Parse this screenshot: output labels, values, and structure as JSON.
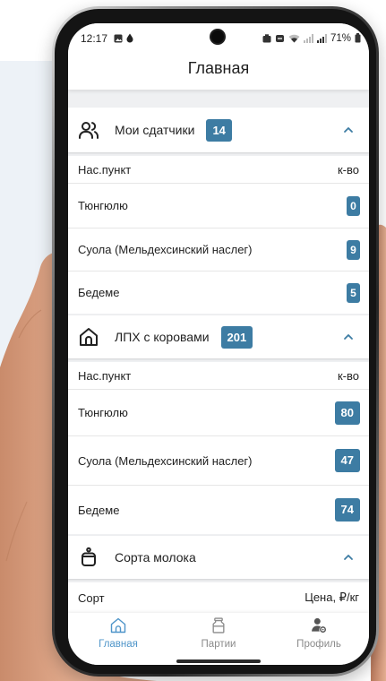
{
  "status_bar": {
    "time": "12:17",
    "battery": "71%",
    "left_icons": [
      "gallery-icon",
      "drop-icon"
    ],
    "right_icons": [
      "battery-saver-icon",
      "alarm-icon",
      "wifi-icon",
      "signal-icon",
      "signal-icon-secondary",
      "battery-icon"
    ]
  },
  "header": {
    "title": "Главная"
  },
  "sections": [
    {
      "icon": "users-icon",
      "title": "Мои сдатчики",
      "count": "14",
      "expanded": true,
      "columns": {
        "name": "Нас.пункт",
        "value": "к-во"
      },
      "rows": [
        {
          "name": "Тюнгюлю",
          "value": "0"
        },
        {
          "name": "Суола (Мельдехсинский наслег)",
          "value": "9"
        },
        {
          "name": "Бедеме",
          "value": "5"
        }
      ]
    },
    {
      "icon": "house-icon",
      "title": "ЛПХ с коровами",
      "count": "201",
      "expanded": true,
      "columns": {
        "name": "Нас.пункт",
        "value": "к-во"
      },
      "rows": [
        {
          "name": "Тюнгюлю",
          "value": "80"
        },
        {
          "name": "Суола (Мельдехсинский наслег)",
          "value": "47"
        },
        {
          "name": "Бедеме",
          "value": "74"
        }
      ]
    },
    {
      "icon": "milk-can-icon",
      "title": "Сорта молока",
      "expanded": true,
      "columns": {
        "name": "Сорт",
        "value": "Цена, ₽/кг"
      }
    }
  ],
  "bottom_nav": [
    {
      "icon": "home-icon",
      "label": "Главная",
      "active": true
    },
    {
      "icon": "milk-can-icon",
      "label": "Партии",
      "active": false
    },
    {
      "icon": "profile-icon",
      "label": "Профиль",
      "active": false
    }
  ],
  "colors": {
    "accent": "#3d7ca3",
    "nav_active": "#4f95c9",
    "nav_inactive": "#8b8b8b",
    "screen_background": "#eff0f2",
    "backdrop_panel": "#edf2f7",
    "phone_frame": "#141414"
  }
}
